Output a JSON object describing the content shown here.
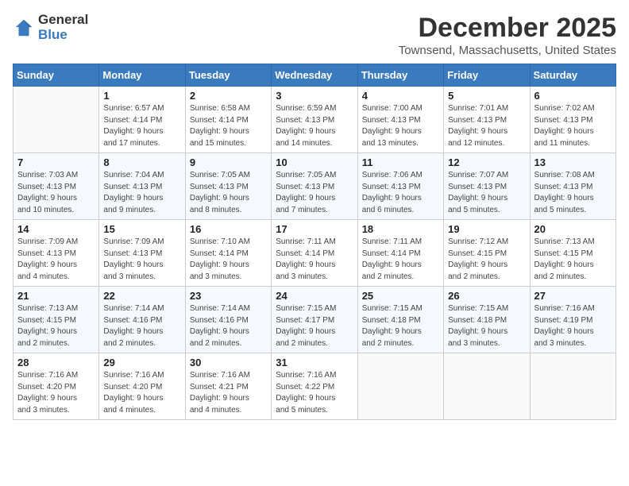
{
  "logo": {
    "general": "General",
    "blue": "Blue"
  },
  "header": {
    "month": "December 2025",
    "location": "Townsend, Massachusetts, United States"
  },
  "days_of_week": [
    "Sunday",
    "Monday",
    "Tuesday",
    "Wednesday",
    "Thursday",
    "Friday",
    "Saturday"
  ],
  "weeks": [
    [
      {
        "day": "",
        "info": ""
      },
      {
        "day": "1",
        "info": "Sunrise: 6:57 AM\nSunset: 4:14 PM\nDaylight: 9 hours\nand 17 minutes."
      },
      {
        "day": "2",
        "info": "Sunrise: 6:58 AM\nSunset: 4:14 PM\nDaylight: 9 hours\nand 15 minutes."
      },
      {
        "day": "3",
        "info": "Sunrise: 6:59 AM\nSunset: 4:13 PM\nDaylight: 9 hours\nand 14 minutes."
      },
      {
        "day": "4",
        "info": "Sunrise: 7:00 AM\nSunset: 4:13 PM\nDaylight: 9 hours\nand 13 minutes."
      },
      {
        "day": "5",
        "info": "Sunrise: 7:01 AM\nSunset: 4:13 PM\nDaylight: 9 hours\nand 12 minutes."
      },
      {
        "day": "6",
        "info": "Sunrise: 7:02 AM\nSunset: 4:13 PM\nDaylight: 9 hours\nand 11 minutes."
      }
    ],
    [
      {
        "day": "7",
        "info": "Sunrise: 7:03 AM\nSunset: 4:13 PM\nDaylight: 9 hours\nand 10 minutes."
      },
      {
        "day": "8",
        "info": "Sunrise: 7:04 AM\nSunset: 4:13 PM\nDaylight: 9 hours\nand 9 minutes."
      },
      {
        "day": "9",
        "info": "Sunrise: 7:05 AM\nSunset: 4:13 PM\nDaylight: 9 hours\nand 8 minutes."
      },
      {
        "day": "10",
        "info": "Sunrise: 7:05 AM\nSunset: 4:13 PM\nDaylight: 9 hours\nand 7 minutes."
      },
      {
        "day": "11",
        "info": "Sunrise: 7:06 AM\nSunset: 4:13 PM\nDaylight: 9 hours\nand 6 minutes."
      },
      {
        "day": "12",
        "info": "Sunrise: 7:07 AM\nSunset: 4:13 PM\nDaylight: 9 hours\nand 5 minutes."
      },
      {
        "day": "13",
        "info": "Sunrise: 7:08 AM\nSunset: 4:13 PM\nDaylight: 9 hours\nand 5 minutes."
      }
    ],
    [
      {
        "day": "14",
        "info": "Sunrise: 7:09 AM\nSunset: 4:13 PM\nDaylight: 9 hours\nand 4 minutes."
      },
      {
        "day": "15",
        "info": "Sunrise: 7:09 AM\nSunset: 4:13 PM\nDaylight: 9 hours\nand 3 minutes."
      },
      {
        "day": "16",
        "info": "Sunrise: 7:10 AM\nSunset: 4:14 PM\nDaylight: 9 hours\nand 3 minutes."
      },
      {
        "day": "17",
        "info": "Sunrise: 7:11 AM\nSunset: 4:14 PM\nDaylight: 9 hours\nand 3 minutes."
      },
      {
        "day": "18",
        "info": "Sunrise: 7:11 AM\nSunset: 4:14 PM\nDaylight: 9 hours\nand 2 minutes."
      },
      {
        "day": "19",
        "info": "Sunrise: 7:12 AM\nSunset: 4:15 PM\nDaylight: 9 hours\nand 2 minutes."
      },
      {
        "day": "20",
        "info": "Sunrise: 7:13 AM\nSunset: 4:15 PM\nDaylight: 9 hours\nand 2 minutes."
      }
    ],
    [
      {
        "day": "21",
        "info": "Sunrise: 7:13 AM\nSunset: 4:15 PM\nDaylight: 9 hours\nand 2 minutes."
      },
      {
        "day": "22",
        "info": "Sunrise: 7:14 AM\nSunset: 4:16 PM\nDaylight: 9 hours\nand 2 minutes."
      },
      {
        "day": "23",
        "info": "Sunrise: 7:14 AM\nSunset: 4:16 PM\nDaylight: 9 hours\nand 2 minutes."
      },
      {
        "day": "24",
        "info": "Sunrise: 7:15 AM\nSunset: 4:17 PM\nDaylight: 9 hours\nand 2 minutes."
      },
      {
        "day": "25",
        "info": "Sunrise: 7:15 AM\nSunset: 4:18 PM\nDaylight: 9 hours\nand 2 minutes."
      },
      {
        "day": "26",
        "info": "Sunrise: 7:15 AM\nSunset: 4:18 PM\nDaylight: 9 hours\nand 3 minutes."
      },
      {
        "day": "27",
        "info": "Sunrise: 7:16 AM\nSunset: 4:19 PM\nDaylight: 9 hours\nand 3 minutes."
      }
    ],
    [
      {
        "day": "28",
        "info": "Sunrise: 7:16 AM\nSunset: 4:20 PM\nDaylight: 9 hours\nand 3 minutes."
      },
      {
        "day": "29",
        "info": "Sunrise: 7:16 AM\nSunset: 4:20 PM\nDaylight: 9 hours\nand 4 minutes."
      },
      {
        "day": "30",
        "info": "Sunrise: 7:16 AM\nSunset: 4:21 PM\nDaylight: 9 hours\nand 4 minutes."
      },
      {
        "day": "31",
        "info": "Sunrise: 7:16 AM\nSunset: 4:22 PM\nDaylight: 9 hours\nand 5 minutes."
      },
      {
        "day": "",
        "info": ""
      },
      {
        "day": "",
        "info": ""
      },
      {
        "day": "",
        "info": ""
      }
    ]
  ]
}
